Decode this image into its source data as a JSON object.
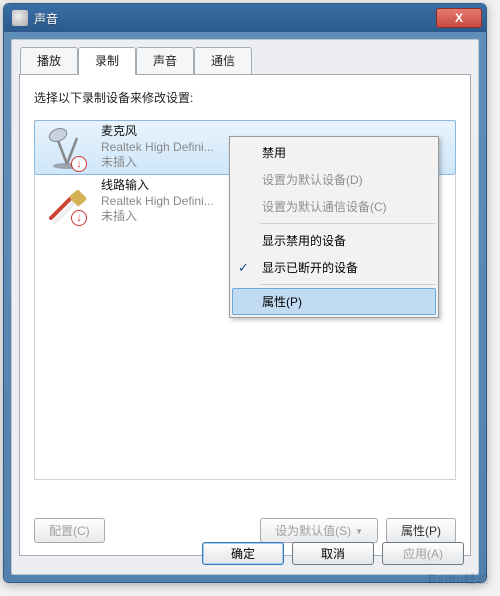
{
  "window": {
    "title": "声音"
  },
  "close_icon": "X",
  "tabs": [
    "播放",
    "录制",
    "声音",
    "通信"
  ],
  "active_tab_index": 1,
  "instruction": "选择以下录制设备来修改设置:",
  "devices": [
    {
      "name": "麦克风",
      "driver": "Realtek High Defini...",
      "status": "未插入",
      "badge": "↓"
    },
    {
      "name": "线路输入",
      "driver": "Realtek High Defini...",
      "status": "未插入",
      "badge": "↓"
    }
  ],
  "buttons": {
    "configure": "配置(C)",
    "set_default": "设为默认值(S)",
    "properties": "属性(P)",
    "ok": "确定",
    "cancel": "取消",
    "apply": "应用(A)"
  },
  "context_menu": {
    "disable": "禁用",
    "set_default_device": "设置为默认设备(D)",
    "set_default_comm": "设置为默认通信设备(C)",
    "show_disabled": "显示禁用的设备",
    "show_disconnected": "显示已断开的设备",
    "properties": "属性(P)"
  }
}
